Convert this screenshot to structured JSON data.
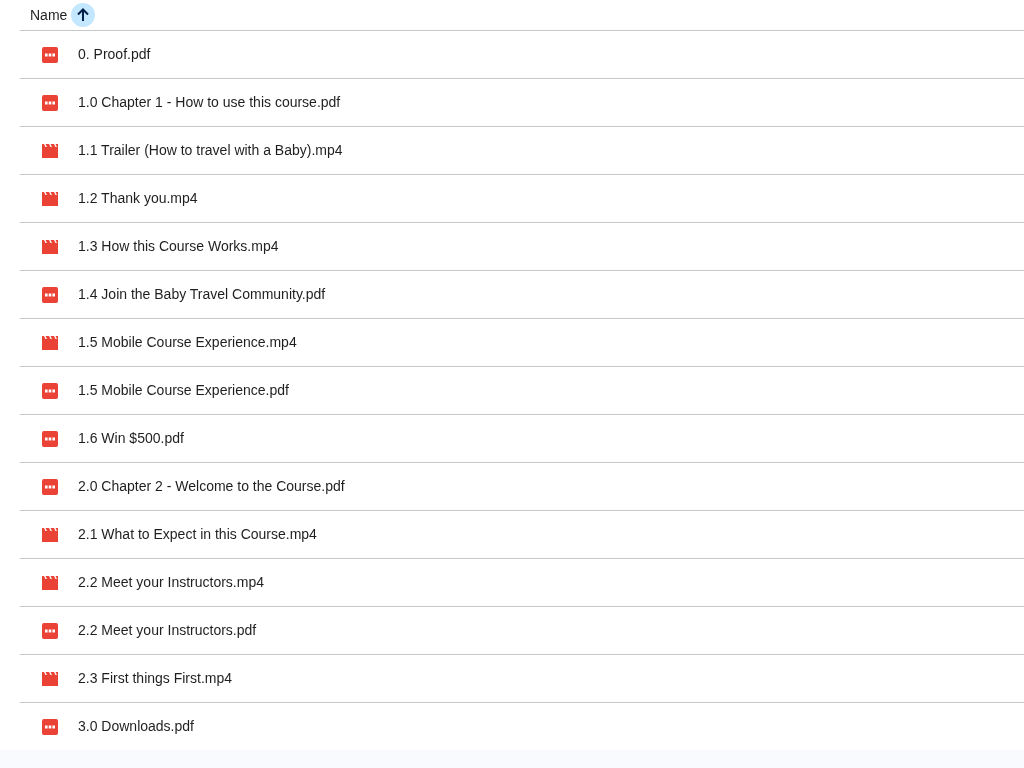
{
  "header": {
    "column": "Name",
    "sort_ascending": true
  },
  "files": [
    {
      "name": "0. Proof.pdf",
      "kind": "pdf"
    },
    {
      "name": "1.0 Chapter 1 - How to use this course.pdf",
      "kind": "pdf"
    },
    {
      "name": "1.1 Trailer (How to travel with a Baby).mp4",
      "kind": "video"
    },
    {
      "name": "1.2 Thank you.mp4",
      "kind": "video"
    },
    {
      "name": "1.3 How this Course Works.mp4",
      "kind": "video"
    },
    {
      "name": "1.4 Join the Baby Travel Community.pdf",
      "kind": "pdf"
    },
    {
      "name": "1.5 Mobile Course Experience.mp4",
      "kind": "video"
    },
    {
      "name": "1.5 Mobile Course Experience.pdf",
      "kind": "pdf"
    },
    {
      "name": "1.6 Win $500.pdf",
      "kind": "pdf"
    },
    {
      "name": "2.0 Chapter 2 - Welcome to the Course.pdf",
      "kind": "pdf"
    },
    {
      "name": "2.1 What to Expect in this Course.mp4",
      "kind": "video"
    },
    {
      "name": "2.2 Meet your Instructors.mp4",
      "kind": "video"
    },
    {
      "name": "2.2 Meet your Instructors.pdf",
      "kind": "pdf"
    },
    {
      "name": "2.3 First things First.mp4",
      "kind": "video"
    },
    {
      "name": "3.0 Downloads.pdf",
      "kind": "pdf"
    }
  ]
}
